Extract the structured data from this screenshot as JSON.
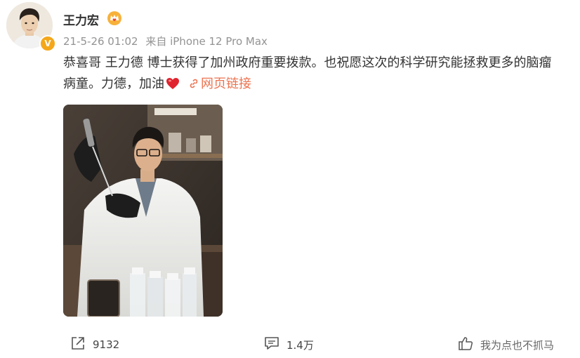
{
  "post": {
    "username": "王力宏",
    "timestamp": "21-5-26 01:02",
    "source": "来自 iPhone 12 Pro Max",
    "text_line1": "恭喜哥 王力德 博士获得了加州政府重要拨款。也祝愿这次的科学研究能拯救更多的脑瘤",
    "text_line2": "病童。力德，加油",
    "weblink_label": "网页链接",
    "verified_badge": "V",
    "icons": [
      "crown-icon",
      "heart-icon",
      "link-icon",
      "repost-icon",
      "comment-icon",
      "like-icon"
    ],
    "accent_color": "#eb7350"
  },
  "footer": {
    "repost_count": "9132",
    "comment_count": "1.4万",
    "watermark": "我为点也不抓马"
  }
}
